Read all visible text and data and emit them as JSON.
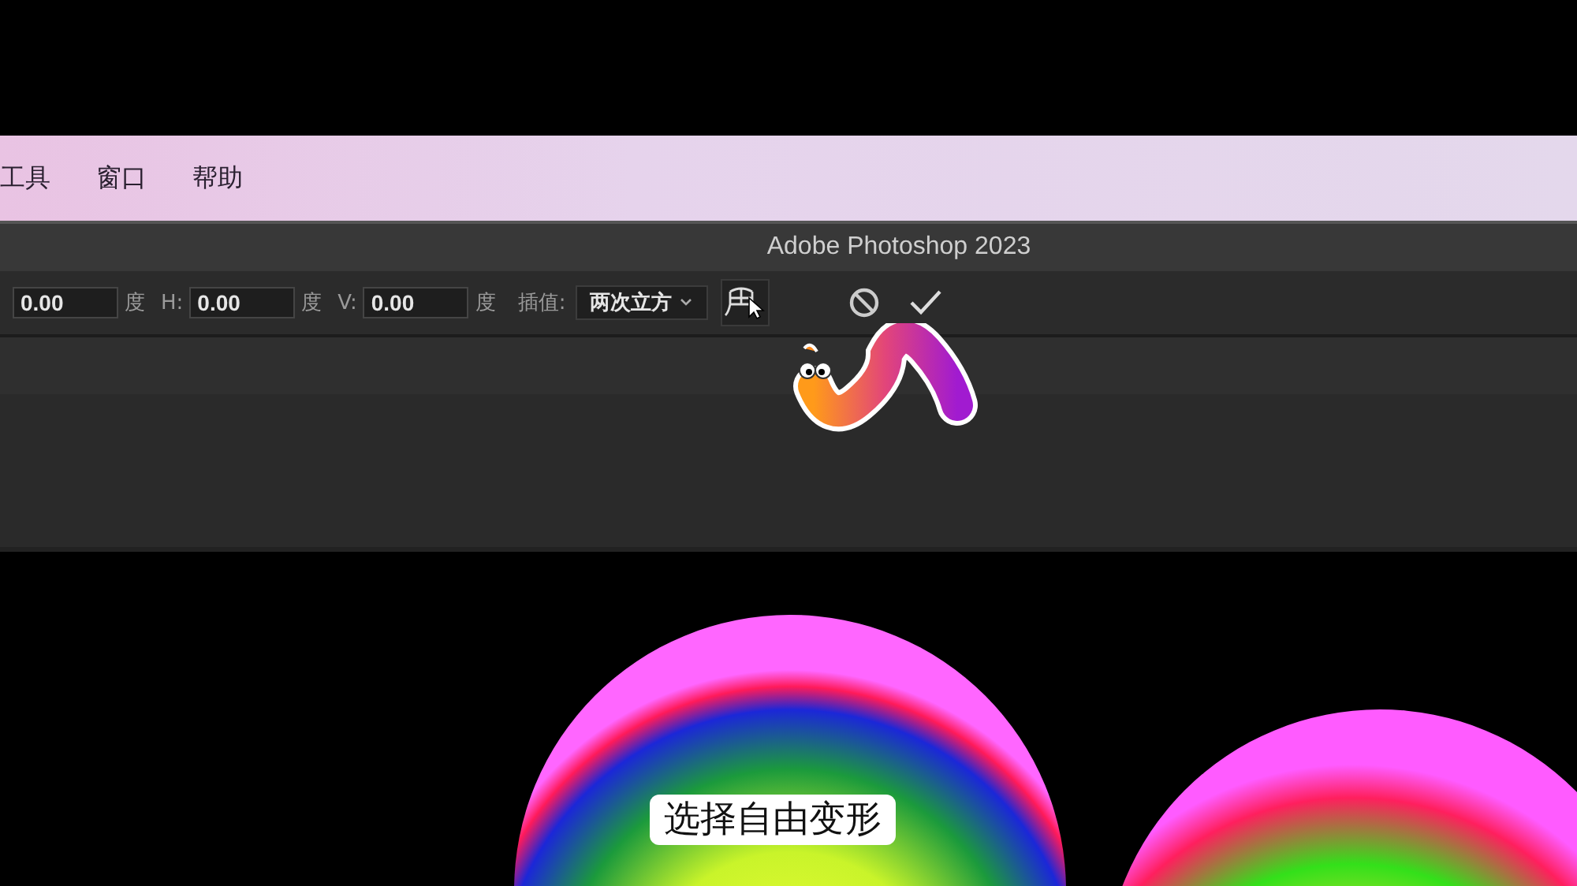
{
  "menu_bar": {
    "items": [
      "工具",
      "窗口",
      "帮助"
    ]
  },
  "window": {
    "title": "Adobe Photoshop 2023"
  },
  "options_bar": {
    "fields": [
      {
        "value": "0.00",
        "unit": "度"
      },
      {
        "label": "H:",
        "value": "0.00",
        "unit": "度"
      },
      {
        "label": "V:",
        "value": "0.00",
        "unit": "度"
      }
    ],
    "interpolation": {
      "label": "插值:",
      "value": "两次立方"
    }
  },
  "caption": "选择自由变形"
}
